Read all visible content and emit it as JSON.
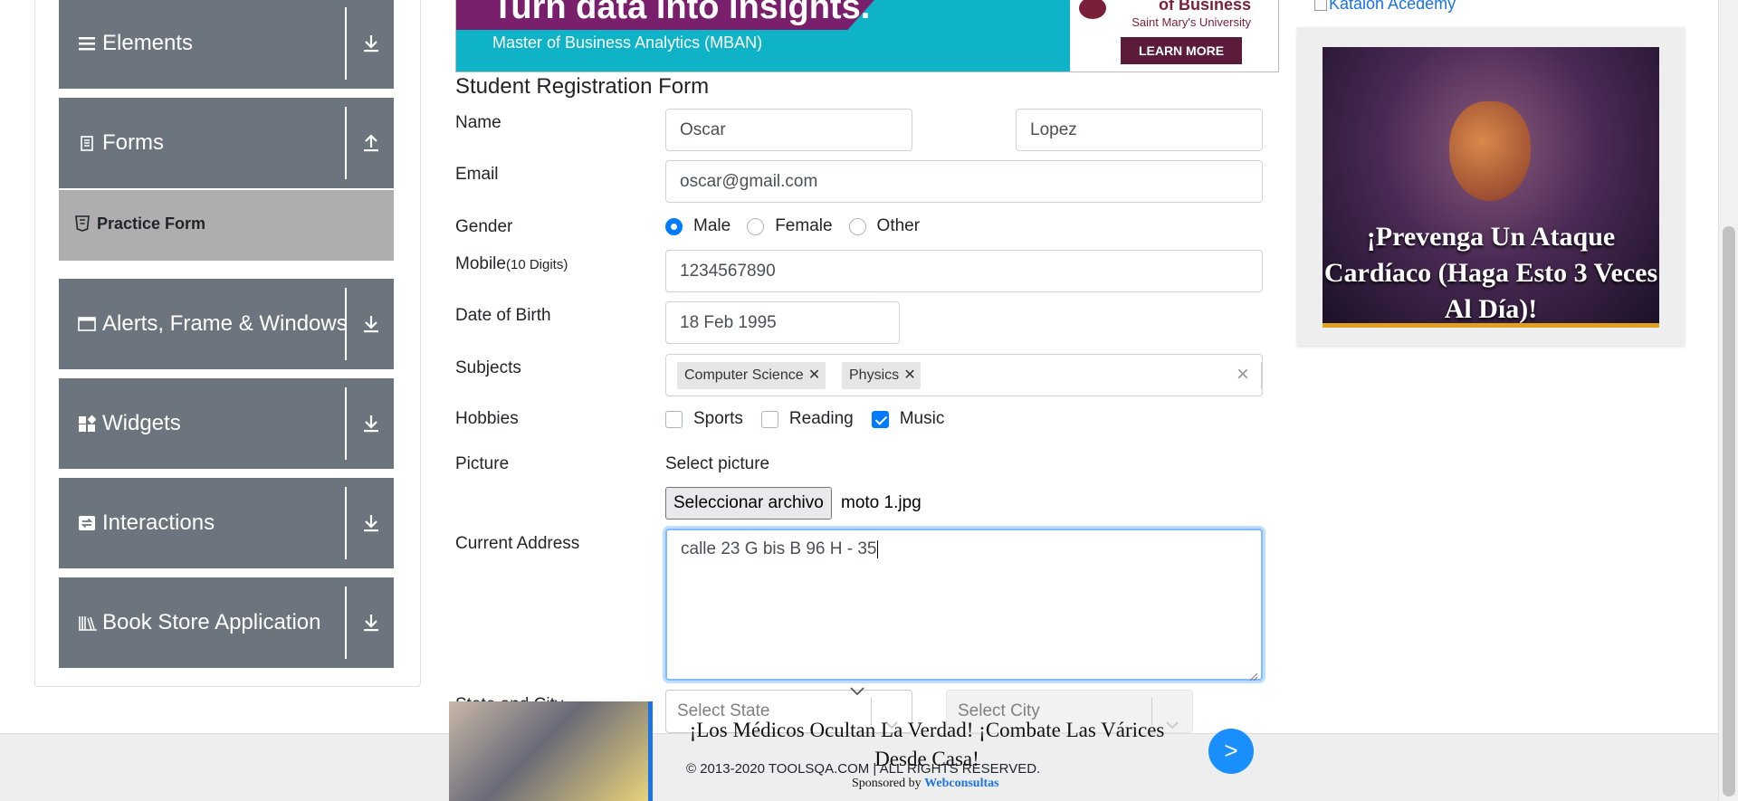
{
  "sidebar": {
    "groups": [
      {
        "label": "Elements",
        "icon": "list-icon",
        "arrow": "download-arrow-icon"
      },
      {
        "label": "Forms",
        "icon": "document-icon",
        "arrow": "upload-arrow-icon"
      },
      {
        "label": "Alerts, Frame & Windows",
        "icon": "window-icon",
        "arrow": "download-arrow-icon"
      },
      {
        "label": "Widgets",
        "icon": "widgets-icon",
        "arrow": "download-arrow-icon"
      },
      {
        "label": "Interactions",
        "icon": "interactions-icon",
        "arrow": "download-arrow-icon"
      },
      {
        "label": "Book Store Application",
        "icon": "books-icon",
        "arrow": "download-arrow-icon"
      }
    ],
    "active_item": "Practice Form"
  },
  "banner": {
    "headline": "Turn data into insights.",
    "subline": "Master of Business Analytics (MBAN)",
    "school": "of Business",
    "university": "Saint Mary's University",
    "cta": "LEARN MORE"
  },
  "form": {
    "title": "Student Registration Form",
    "name_label": "Name",
    "first_name": "Oscar",
    "last_name": "Lopez",
    "email_label": "Email",
    "email": "oscar@gmail.com",
    "gender_label": "Gender",
    "gender_options": [
      "Male",
      "Female",
      "Other"
    ],
    "gender_selected": "Male",
    "mobile_label": "Mobile",
    "mobile_hint": "(10 Digits)",
    "mobile": "1234567890",
    "dob_label": "Date of Birth",
    "dob": "18 Feb 1995",
    "subjects_label": "Subjects",
    "subjects": [
      "Computer Science",
      "Physics"
    ],
    "hobbies_label": "Hobbies",
    "hobbies": [
      {
        "label": "Sports",
        "checked": false
      },
      {
        "label": "Reading",
        "checked": false
      },
      {
        "label": "Music",
        "checked": true
      }
    ],
    "picture_label": "Picture",
    "picture_prompt": "Select picture",
    "file_button": "Seleccionar archivo",
    "file_name": "moto 1.jpg",
    "address_label": "Current Address",
    "address": "calle 23 G bis B 96 H - 35",
    "state_city_label": "State and City",
    "state_placeholder": "Select State",
    "city_placeholder": "Select City"
  },
  "side_ad": {
    "link_text": "Katalon Acedemy",
    "headline": "¡Prevenga Un Ataque Cardíaco (Haga Esto 3 Veces Al Día)!"
  },
  "bottom_ad": {
    "headline": "¡Los Médicos Ocultan La Verdad! ¡Combate Las Várices Desde Casa!",
    "cta": ">",
    "sponsored_prefix": "Sponsored by",
    "sponsor": "Webconsultas"
  },
  "footer": {
    "copyright": "© 2013-2020 TOOLSQA.COM | ALL RIGHTS RESERVED."
  },
  "colors": {
    "sidebar_group": "#6c757d",
    "active_item": "#aeaeae",
    "accent": "#007bff"
  }
}
